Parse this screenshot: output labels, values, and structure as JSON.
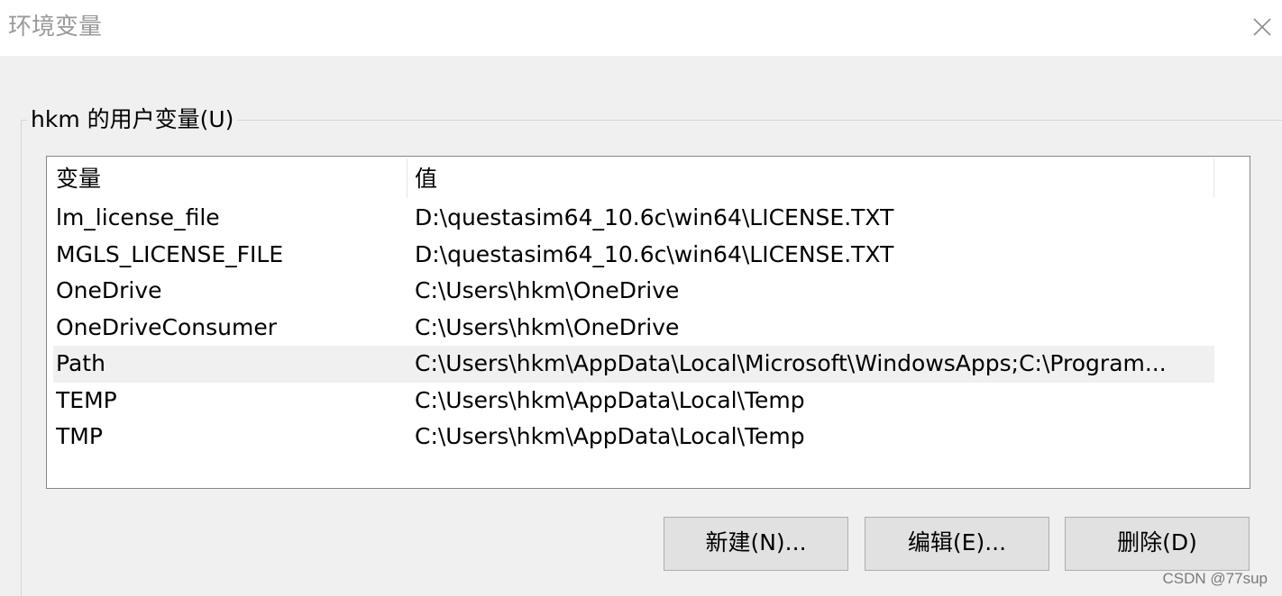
{
  "window": {
    "title": "环境变量"
  },
  "user_vars": {
    "group_label": "hkm 的用户变量(U)",
    "columns": {
      "name": "变量",
      "value": "值"
    },
    "rows": [
      {
        "name": "lm_license_file",
        "value": "D:\\questasim64_10.6c\\win64\\LICENSE.TXT",
        "selected": false
      },
      {
        "name": "MGLS_LICENSE_FILE",
        "value": "D:\\questasim64_10.6c\\win64\\LICENSE.TXT",
        "selected": false
      },
      {
        "name": "OneDrive",
        "value": "C:\\Users\\hkm\\OneDrive",
        "selected": false
      },
      {
        "name": "OneDriveConsumer",
        "value": "C:\\Users\\hkm\\OneDrive",
        "selected": false
      },
      {
        "name": "Path",
        "value": "C:\\Users\\hkm\\AppData\\Local\\Microsoft\\WindowsApps;C:\\Program...",
        "selected": true
      },
      {
        "name": "TEMP",
        "value": "C:\\Users\\hkm\\AppData\\Local\\Temp",
        "selected": false
      },
      {
        "name": "TMP",
        "value": "C:\\Users\\hkm\\AppData\\Local\\Temp",
        "selected": false
      }
    ]
  },
  "buttons": {
    "new_label": "新建(N)...",
    "edit_label": "编辑(E)...",
    "delete_label": "删除(D)"
  },
  "watermark": "CSDN @77sup",
  "icons": {
    "close": "close-icon"
  }
}
